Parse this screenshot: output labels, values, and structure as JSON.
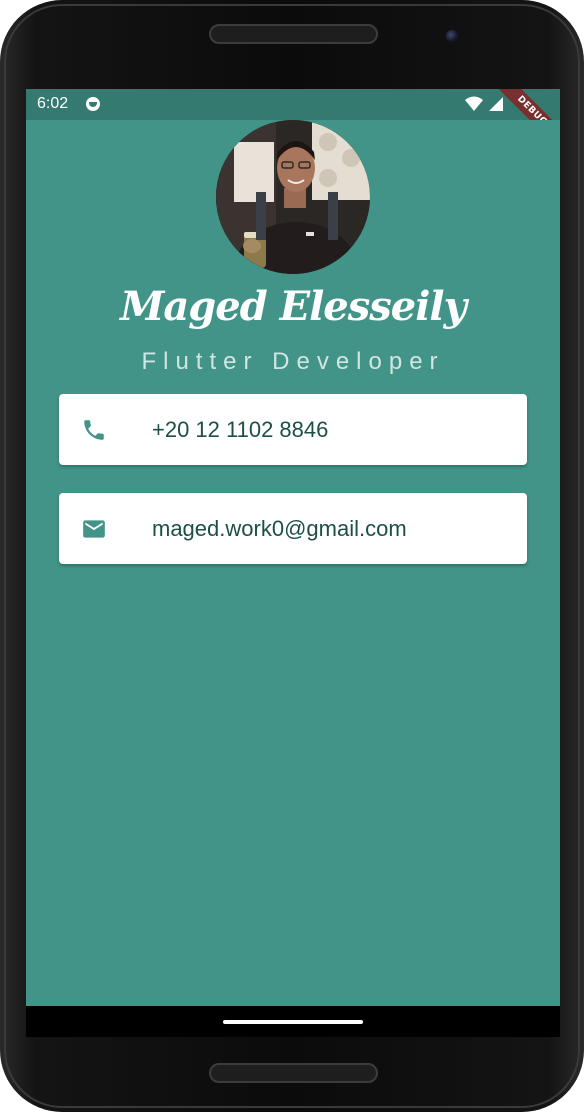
{
  "status_bar": {
    "time": "6:02",
    "app_icon": "android-app-icon",
    "wifi_icon": "wifi-icon",
    "signal_icon": "signal-icon",
    "debug_banner": "DEBUG"
  },
  "profile": {
    "avatar": "profile-photo",
    "name": "Maged Elesseily",
    "title": "Flutter Developer"
  },
  "contacts": [
    {
      "icon": "phone-icon",
      "text": "+20 12 1102 8846"
    },
    {
      "icon": "mail-icon",
      "text": "maged.work0@gmail.com"
    }
  ],
  "colors": {
    "background": "#429488",
    "status_bar": "#357a71",
    "card": "#ffffff",
    "card_text": "#1e4f47",
    "icon": "#429488",
    "debug_banner": "#7a2f2f"
  }
}
